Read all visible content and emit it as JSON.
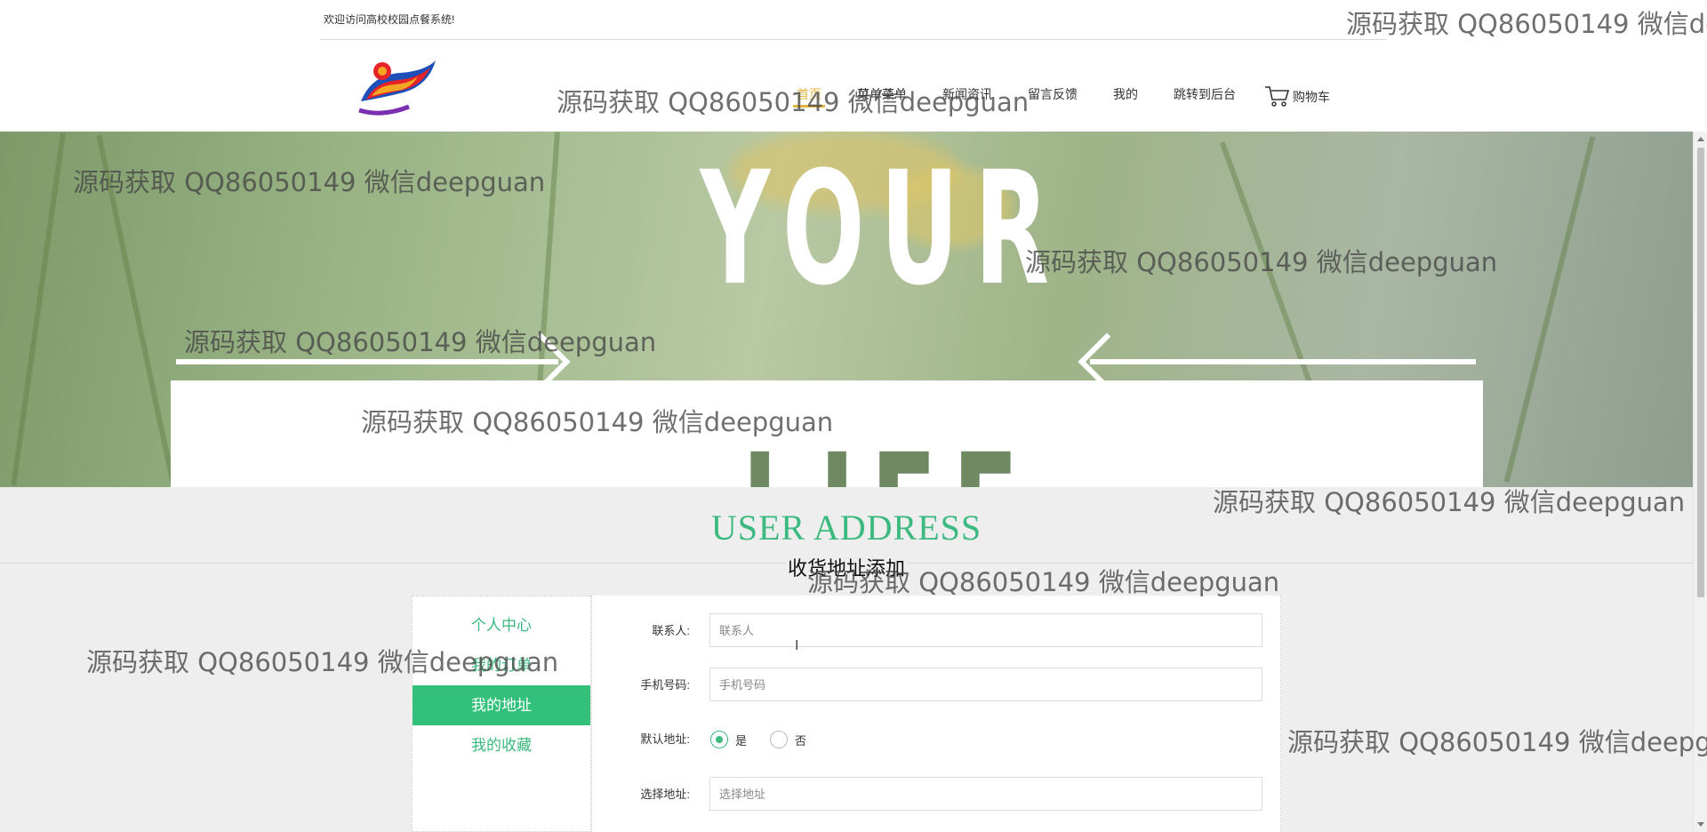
{
  "header": {
    "welcome": "欢迎访问高校校园点餐系统!",
    "nav": [
      {
        "label": "首页",
        "active": true
      },
      {
        "label": "菜单菜单",
        "active": false
      },
      {
        "label": "新闻资讯",
        "active": false
      },
      {
        "label": "留言反馈",
        "active": false
      },
      {
        "label": "我的",
        "active": false
      },
      {
        "label": "跳转到后台",
        "active": false
      }
    ],
    "cart_label": "购物车",
    "cart_icon": "cart-icon",
    "logo_icon": "logo-icon"
  },
  "banner": {
    "word_top": "YOUR",
    "word_bottom": "LIFE"
  },
  "section": {
    "title": "USER ADDRESS",
    "subtitle": "收货地址添加"
  },
  "sidebar": {
    "items": [
      {
        "label": "个人中心",
        "active": false
      },
      {
        "label": "我的订单",
        "active": false
      },
      {
        "label": "我的地址",
        "active": true
      },
      {
        "label": "我的收藏",
        "active": false
      }
    ]
  },
  "form": {
    "contact": {
      "label": "联系人:",
      "placeholder": "联系人"
    },
    "phone": {
      "label": "手机号码:",
      "placeholder": "手机号码"
    },
    "default": {
      "label": "默认地址:",
      "yes": "是",
      "no": "否",
      "selected": "是"
    },
    "address": {
      "label": "选择地址:",
      "placeholder": "选择地址"
    }
  },
  "watermark": "源码获取 QQ86050149 微信deepguan",
  "colors": {
    "accent": "#3bb97e",
    "nav_active": "#e2b63e"
  }
}
